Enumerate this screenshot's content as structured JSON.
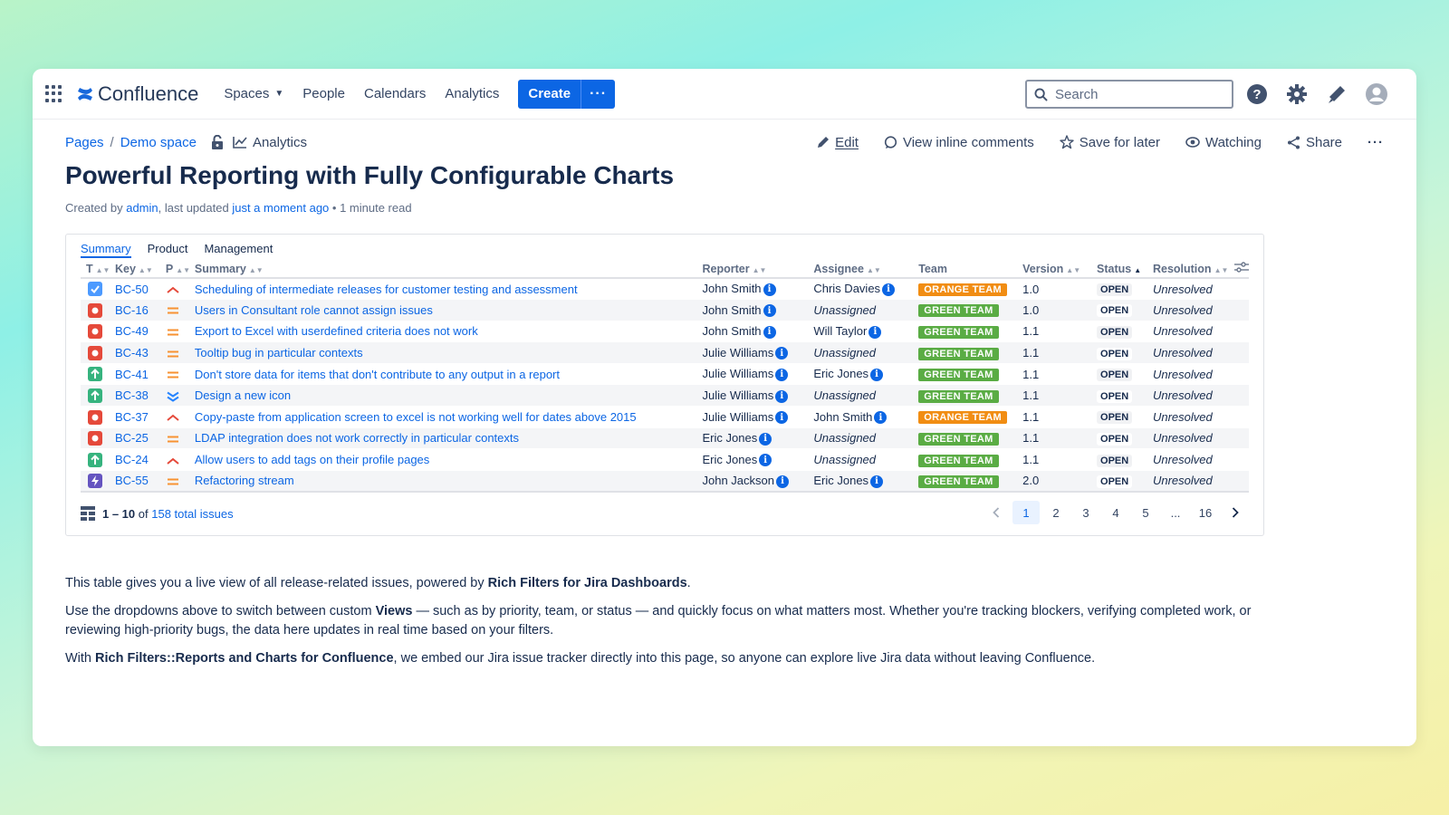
{
  "app": {
    "name": "Confluence",
    "nav": [
      "Spaces",
      "People",
      "Calendars",
      "Analytics"
    ],
    "create_label": "Create",
    "more_label": "···",
    "search_placeholder": "Search"
  },
  "breadcrumb": [
    "Pages",
    "Demo space"
  ],
  "analytics_label": "Analytics",
  "page_actions": {
    "edit": "Edit",
    "comments": "View inline comments",
    "save": "Save for later",
    "watch": "Watching",
    "share": "Share",
    "more": "···"
  },
  "page": {
    "title": "Powerful Reporting with Fully Configurable Charts",
    "meta_prefix": "Created by",
    "author": "admin",
    "meta_mid": ", last updated",
    "updated": "just a moment ago",
    "read_time": "• 1 minute read"
  },
  "report": {
    "tabs": [
      "Summary",
      "Product",
      "Management"
    ],
    "columns": [
      "T",
      "Key",
      "P",
      "Summary",
      "Reporter",
      "Assignee",
      "Team",
      "Version",
      "Status",
      "Resolution"
    ],
    "rows": [
      {
        "type": "task",
        "key": "BC-50",
        "priority": "high",
        "summary": "Scheduling of intermediate releases for customer testing and assessment",
        "reporter": "John Smith",
        "assignee": "Chris Davies",
        "team": "ORANGE TEAM",
        "version": "1.0",
        "status": "OPEN",
        "resolution": "Unresolved"
      },
      {
        "type": "bug",
        "key": "BC-16",
        "priority": "medium",
        "summary": "Users in Consultant role cannot assign issues",
        "reporter": "John Smith",
        "assignee": "Unassigned",
        "team": "GREEN TEAM",
        "version": "1.0",
        "status": "OPEN",
        "resolution": "Unresolved"
      },
      {
        "type": "bug",
        "key": "BC-49",
        "priority": "medium",
        "summary": "Export to Excel with userdefined criteria does not work",
        "reporter": "John Smith",
        "assignee": "Will Taylor",
        "team": "GREEN TEAM",
        "version": "1.1",
        "status": "OPEN",
        "resolution": "Unresolved"
      },
      {
        "type": "bug",
        "key": "BC-43",
        "priority": "medium",
        "summary": "Tooltip bug in particular contexts",
        "reporter": "Julie Williams",
        "assignee": "Unassigned",
        "team": "GREEN TEAM",
        "version": "1.1",
        "status": "OPEN",
        "resolution": "Unresolved"
      },
      {
        "type": "improvement",
        "key": "BC-41",
        "priority": "medium",
        "summary": "Don't store data for items that don't contribute to any output in a report",
        "reporter": "Julie Williams",
        "assignee": "Eric Jones",
        "team": "GREEN TEAM",
        "version": "1.1",
        "status": "OPEN",
        "resolution": "Unresolved"
      },
      {
        "type": "improvement",
        "key": "BC-38",
        "priority": "lowest",
        "summary": "Design a new icon",
        "reporter": "Julie Williams",
        "assignee": "Unassigned",
        "team": "GREEN TEAM",
        "version": "1.1",
        "status": "OPEN",
        "resolution": "Unresolved"
      },
      {
        "type": "bug",
        "key": "BC-37",
        "priority": "high",
        "summary": "Copy-paste from application screen to excel is not working well for dates above 2015",
        "reporter": "Julie Williams",
        "assignee": "John Smith",
        "team": "ORANGE TEAM",
        "version": "1.1",
        "status": "OPEN",
        "resolution": "Unresolved"
      },
      {
        "type": "bug",
        "key": "BC-25",
        "priority": "medium",
        "summary": "LDAP integration does not work correctly in particular contexts",
        "reporter": "Eric Jones",
        "assignee": "Unassigned",
        "team": "GREEN TEAM",
        "version": "1.1",
        "status": "OPEN",
        "resolution": "Unresolved"
      },
      {
        "type": "improvement",
        "key": "BC-24",
        "priority": "high",
        "summary": "Allow users to add tags on their profile pages",
        "reporter": "Eric Jones",
        "assignee": "Unassigned",
        "team": "GREEN TEAM",
        "version": "1.1",
        "status": "OPEN",
        "resolution": "Unresolved"
      },
      {
        "type": "epic",
        "key": "BC-55",
        "priority": "medium",
        "summary": "Refactoring stream",
        "reporter": "John Jackson",
        "assignee": "Eric Jones",
        "team": "GREEN TEAM",
        "version": "2.0",
        "status": "OPEN",
        "resolution": "Unresolved"
      }
    ],
    "range": "1 – 10",
    "of_label": "of",
    "total": "158 total issues",
    "pages": [
      "1",
      "2",
      "3",
      "4",
      "5",
      "...",
      "16"
    ],
    "current_page": "1"
  },
  "body": {
    "p1_pre": "This table gives you a live view of all release-related issues, powered by ",
    "p1_bold": "Rich Filters for Jira Dashboards",
    "p1_post": ".",
    "p2_pre": "Use the dropdowns above to switch between custom ",
    "p2_bold": "Views",
    "p2_post": " — such as by priority, team, or status — and quickly focus on what matters most. Whether you're tracking blockers, verifying completed work, or reviewing high-priority bugs, the data here updates in real time based on your filters.",
    "p3_pre": "With ",
    "p3_bold": "Rich Filters::Reports and Charts for Confluence",
    "p3_post": ", we embed our Jira issue tracker directly into this page, so anyone can explore live Jira data without leaving Confluence."
  },
  "colors": {
    "accent": "#0c66e4",
    "orange_team": "#f18d13",
    "green_team": "#5aac44",
    "bug": "#e5493a",
    "improvement": "#36b37e",
    "task": "#4c9aff",
    "epic": "#6554c0"
  },
  "icons": {
    "app_switcher": "grid-icon",
    "search": "search-icon",
    "help": "help-icon",
    "settings": "gear-icon",
    "notifications": "megaphone-icon",
    "profile": "avatar-icon"
  }
}
